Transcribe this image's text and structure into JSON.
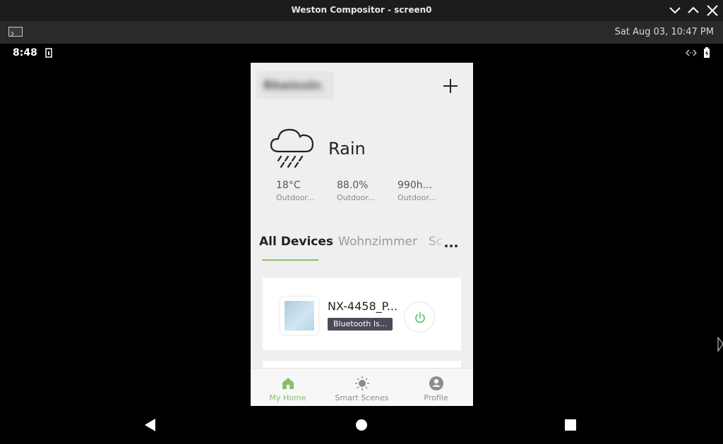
{
  "window": {
    "title": "Weston Compositor - screen0"
  },
  "panel": {
    "clock": "Sat Aug 03, 10:47 PM"
  },
  "statusbar": {
    "time": "8:48"
  },
  "home": {
    "name": "Rheinstr."
  },
  "weather": {
    "condition": "Rain",
    "stats": [
      {
        "value": "18°C",
        "label": "Outdoor..."
      },
      {
        "value": "88.0%",
        "label": "Outdoor..."
      },
      {
        "value": "990h...",
        "label": "Outdoor..."
      }
    ]
  },
  "tabs": [
    {
      "label": "All Devices",
      "active": true
    },
    {
      "label": "Wohnzimmer",
      "active": false
    },
    {
      "label": "Sc",
      "active": false
    }
  ],
  "devices": [
    {
      "name": "NX-4458_P...",
      "badge": "Bluetooth Is..."
    }
  ],
  "bottom_nav": [
    {
      "label": "My Home",
      "icon": "home-icon",
      "active": true
    },
    {
      "label": "Smart Scenes",
      "icon": "sun-icon",
      "active": false
    },
    {
      "label": "Profile",
      "icon": "profile-icon",
      "active": false
    }
  ],
  "colors": {
    "accent": "#8bbd6d",
    "power_green": "#4cc16a",
    "badge_bg": "#4a4a58",
    "nav_inactive": "#8c8c8c"
  }
}
